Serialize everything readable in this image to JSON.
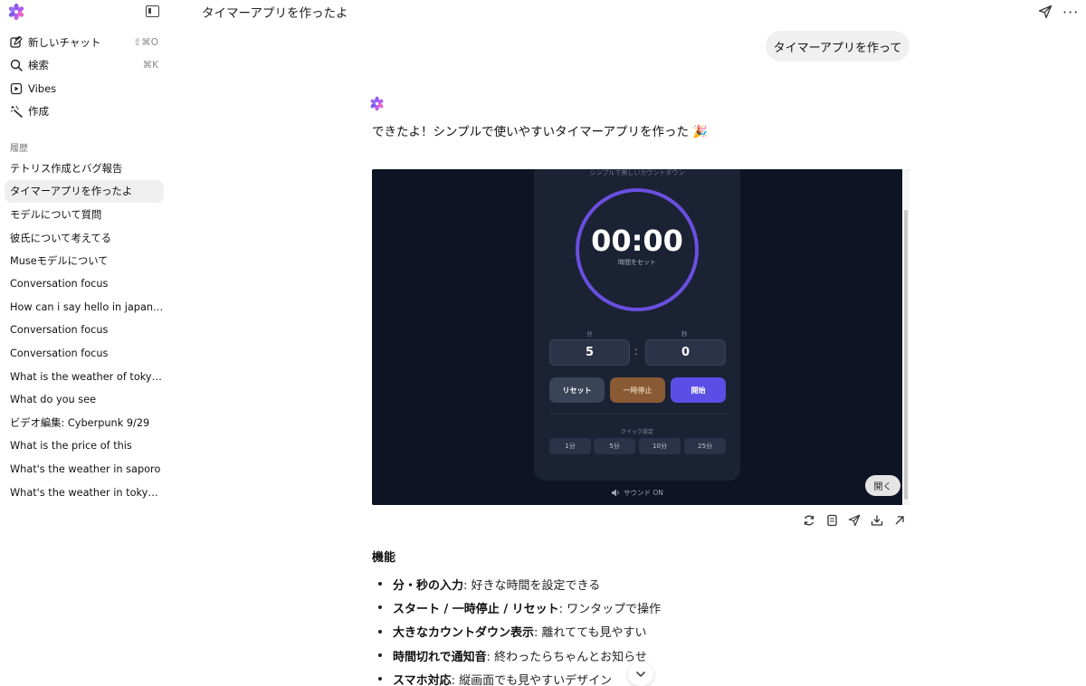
{
  "header": {
    "title": "タイマーアプリを作ったよ"
  },
  "sidebar": {
    "nav": [
      {
        "label": "新しいチャット",
        "shortcut": "⇧⌘O"
      },
      {
        "label": "検索",
        "shortcut": "⌘K"
      },
      {
        "label": "Vibes",
        "shortcut": ""
      },
      {
        "label": "作成",
        "shortcut": ""
      }
    ],
    "history_label": "履歴",
    "history": [
      "テトリス作成とバグ報告",
      "タイマーアプリを作ったよ",
      "モデルについて質問",
      "彼氏について考えてる",
      "Museモデルについて",
      "Conversation focus",
      "How can i say hello in japanese",
      "Conversation focus",
      "Conversation focus",
      "What is the weather of tokyo today",
      "What do you see",
      "ビデオ編集: Cyberpunk 9/29",
      "What is the price of this",
      "What's the weather in saporo",
      "What's the weather in tokyo today"
    ],
    "active_index": 1
  },
  "chat": {
    "user_message": "タイマーアプリを作って",
    "ai_intro": "できたよ！シンプルで使いやすいタイマーアプリを作った 🎉"
  },
  "preview": {
    "subtitle": "シンプルで美しいカウントダウン",
    "time": "00:00",
    "time_label": "時間をセット",
    "min_label": "分",
    "sec_label": "秒",
    "min_value": "5",
    "sec_value": "0",
    "colon": ":",
    "reset": "リセット",
    "pause": "一時停止",
    "start": "開始",
    "quick_label": "クイック設定",
    "quick": [
      "1分",
      "5分",
      "10分",
      "25分"
    ],
    "sound": "サウンド ON",
    "open": "開く",
    "colors": {
      "ring": "#6b4fe0",
      "start": "#5b4ee6",
      "pause": "#8a5a34",
      "bg": "#0e1424"
    }
  },
  "features": {
    "title": "機能",
    "items": [
      {
        "bold": "分・秒の入力",
        "text": ": 好きな時間を設定できる"
      },
      {
        "bold": "スタート / 一時停止 / リセット",
        "text": ": ワンタップで操作"
      },
      {
        "bold": "大きなカウントダウン表示",
        "text": ": 離れてても見やすい"
      },
      {
        "bold": "時間切れで通知音",
        "text": ": 終わったらちゃんとお知らせ"
      },
      {
        "bold": "スマホ対応",
        "text": ": 縦画面でも見やすいデザイン"
      }
    ]
  },
  "icons": [
    "logo-icon",
    "sidebar-toggle-icon",
    "new-chat-icon",
    "search-icon",
    "play-icon",
    "magic-wand-icon",
    "share-icon",
    "more-icon",
    "refresh-icon",
    "copy-icon",
    "send-icon",
    "download-icon",
    "open-external-icon",
    "speaker-icon",
    "chevron-down-icon"
  ]
}
